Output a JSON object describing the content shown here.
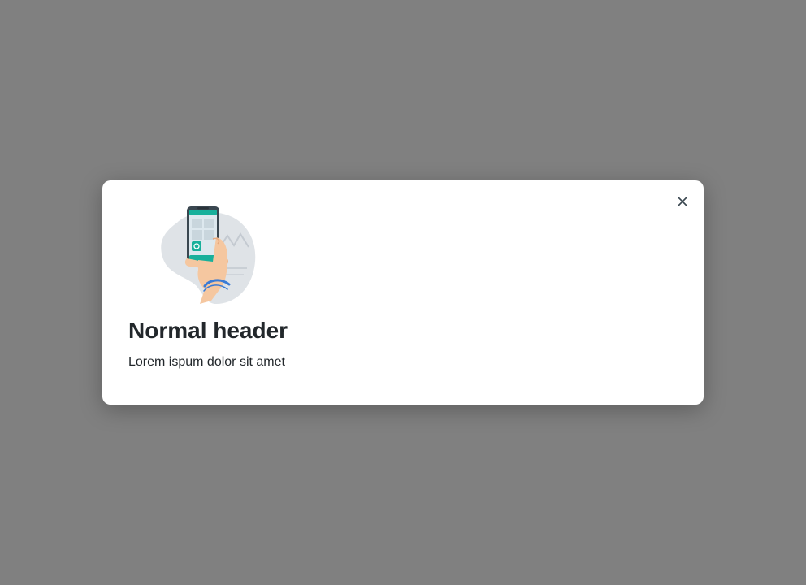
{
  "overlay": {
    "color": "#808080"
  },
  "modal": {
    "title": "Normal header",
    "description": "Lorem ispum dolor sit amet",
    "close_icon": "close-icon",
    "illustration_icon": "hand-holding-phone-icon"
  },
  "colors": {
    "text": "#22272b",
    "accent": "#18b09b",
    "skin": "#f5c7a0"
  }
}
